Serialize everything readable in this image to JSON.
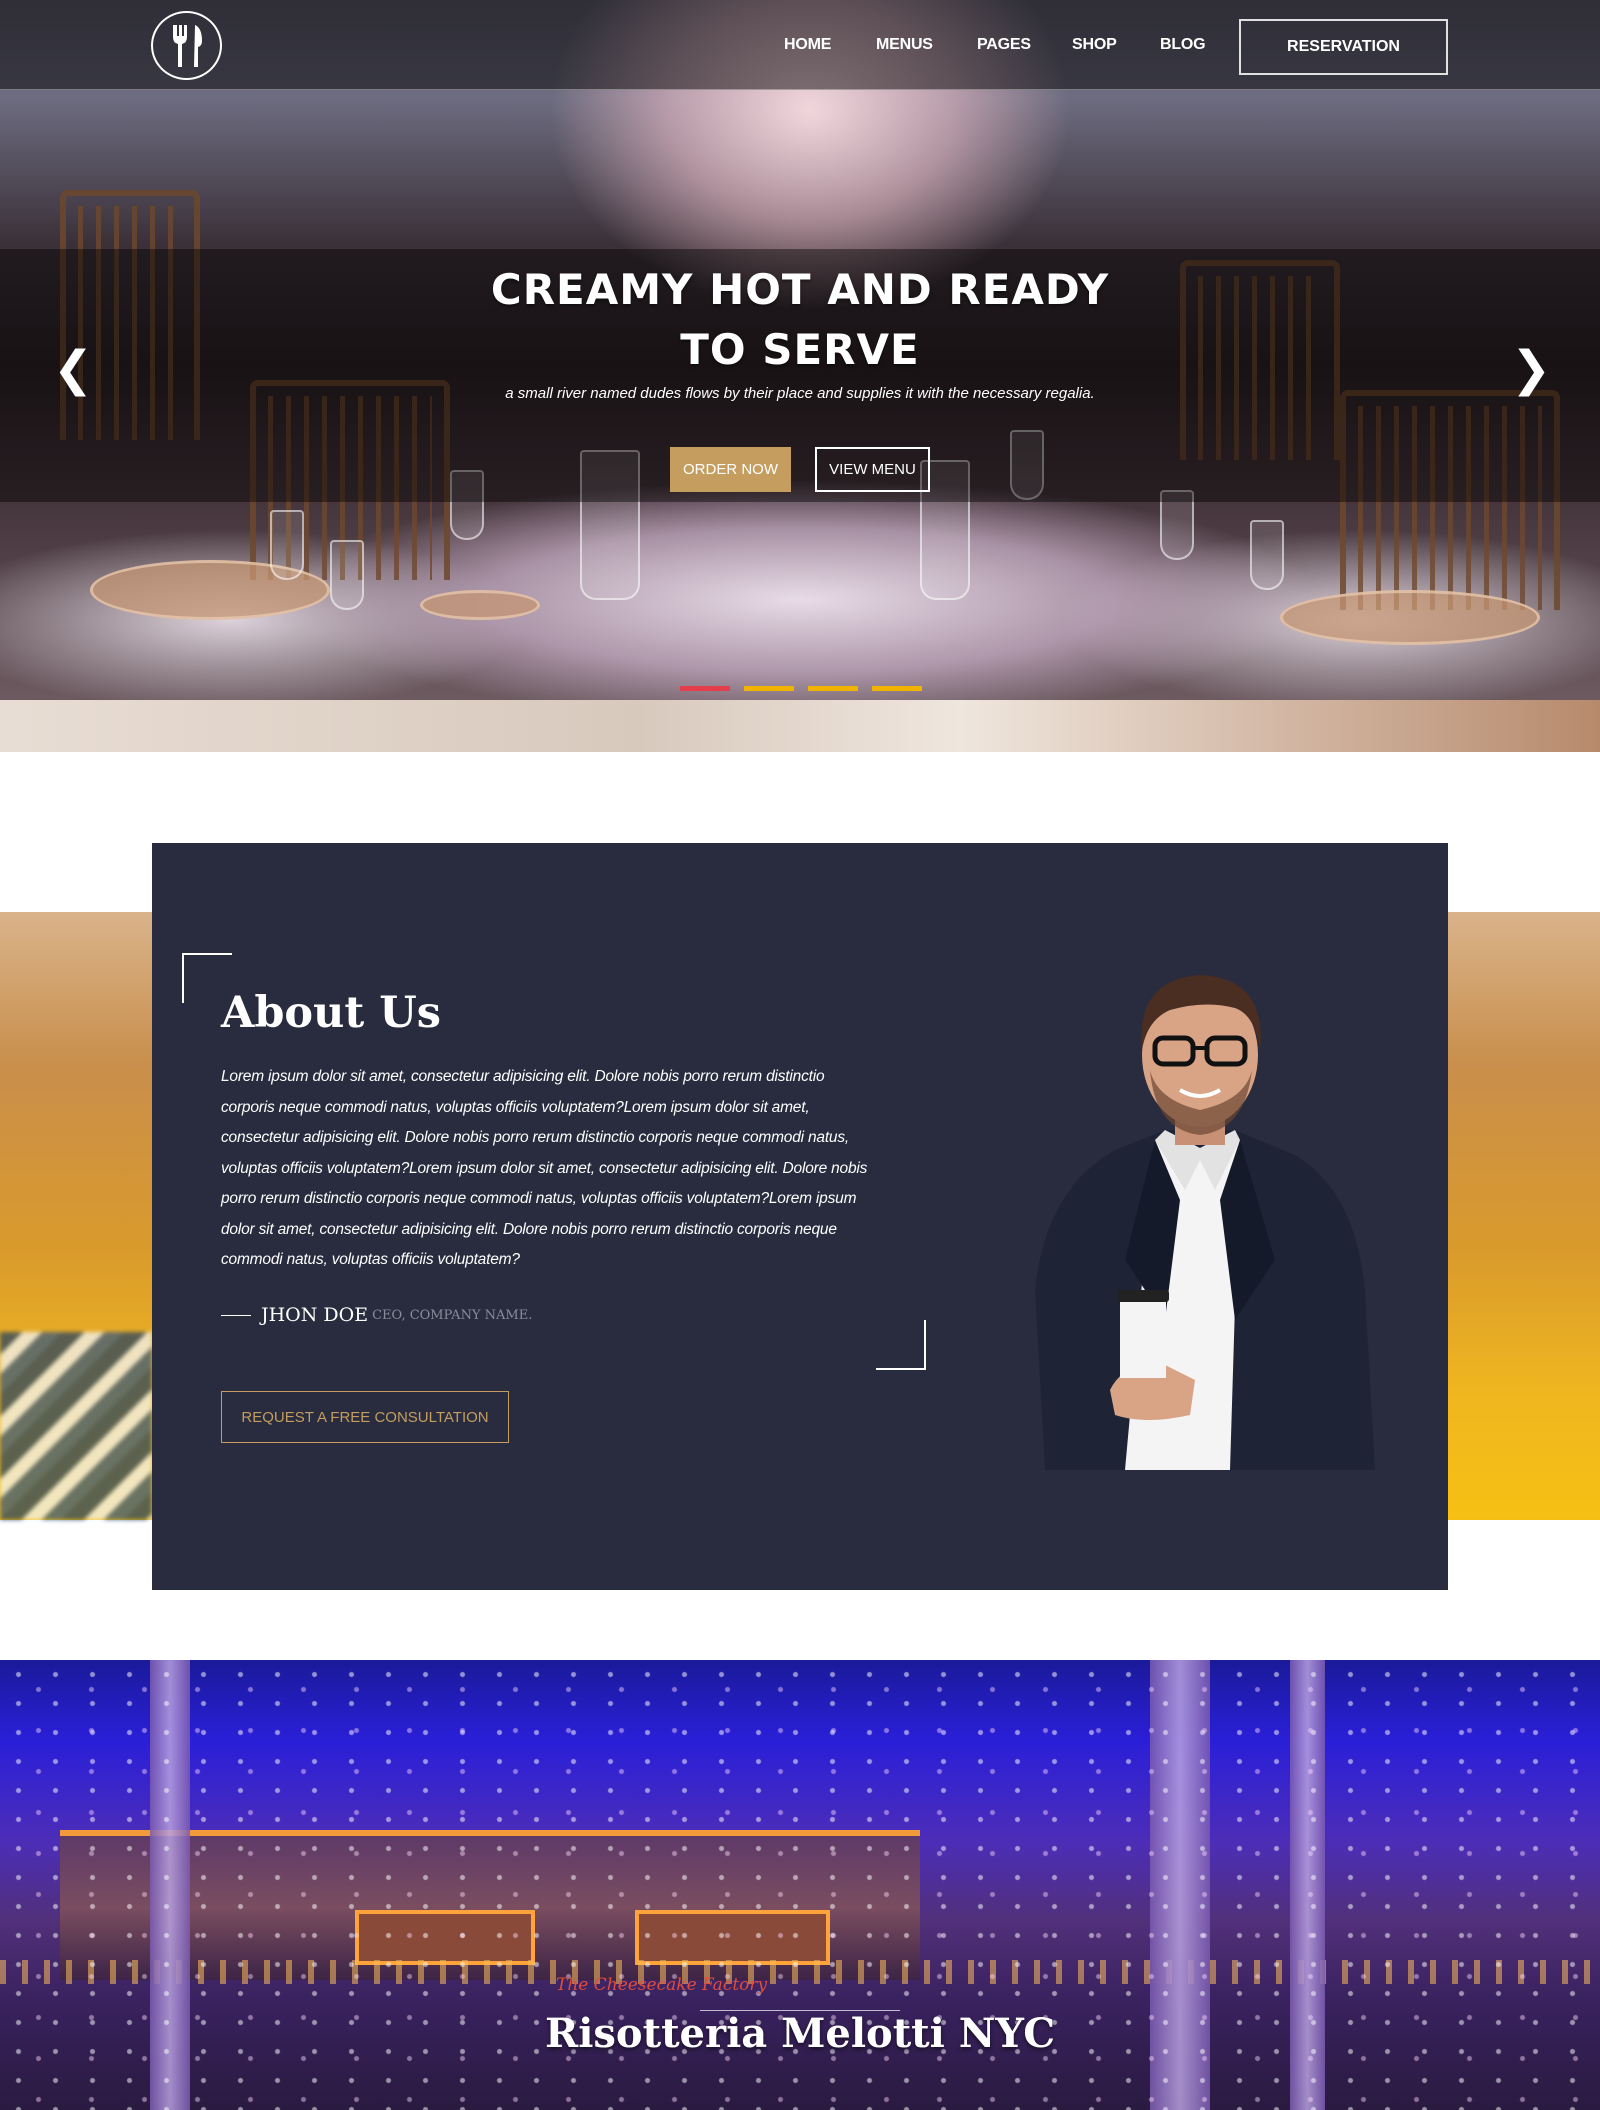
{
  "header": {
    "nav": [
      {
        "label": "HOME"
      },
      {
        "label": "MENUS"
      },
      {
        "label": "PAGES"
      },
      {
        "label": "SHOP"
      },
      {
        "label": "BLOG"
      }
    ],
    "reservation_label": "RESERVATION",
    "logo_icon": "fork-and-knife-icon"
  },
  "hero": {
    "title": "CREAMY HOT AND READY TO SERVE",
    "subtitle": "a small river named dudes flows by their place and supplies it with the necessary regalia.",
    "order_label": "ORDER NOW",
    "view_menu_label": "VIEW MENU",
    "prev_icon": "chevron-left-icon",
    "next_icon": "chevron-right-icon",
    "prev_glyph": "❮",
    "next_glyph": "❯",
    "slide_count": 4,
    "active_slide": 1,
    "dot_colors": {
      "active": "#e43e4a",
      "inactive": "#f0b400"
    }
  },
  "about": {
    "title": "About Us",
    "body": "Lorem ipsum dolor sit amet, consectetur adipisicing elit. Dolore nobis porro rerum distinctio corporis neque commodi natus, voluptas officiis voluptatem?Lorem ipsum dolor sit amet, consectetur adipisicing elit. Dolore nobis porro rerum distinctio corporis neque commodi natus, voluptas officiis voluptatem?Lorem ipsum dolor sit amet, consectetur adipisicing elit. Dolore nobis porro rerum distinctio corporis neque commodi natus, voluptas officiis voluptatem?Lorem ipsum dolor sit amet, consectetur adipisicing elit. Dolore nobis porro rerum distinctio corporis neque commodi natus, voluptas officiis voluptatem?",
    "author_name": "JHON DOE",
    "author_role": "CEO, COMPANY NAME.",
    "cta_label": "REQUEST A FREE CONSULTATION"
  },
  "venue": {
    "title": "Risotteria Melotti NYC",
    "sign_text": "The Cheesecake Factory"
  },
  "colors": {
    "accent": "#c59d5f",
    "card_bg": "#282c3e"
  }
}
